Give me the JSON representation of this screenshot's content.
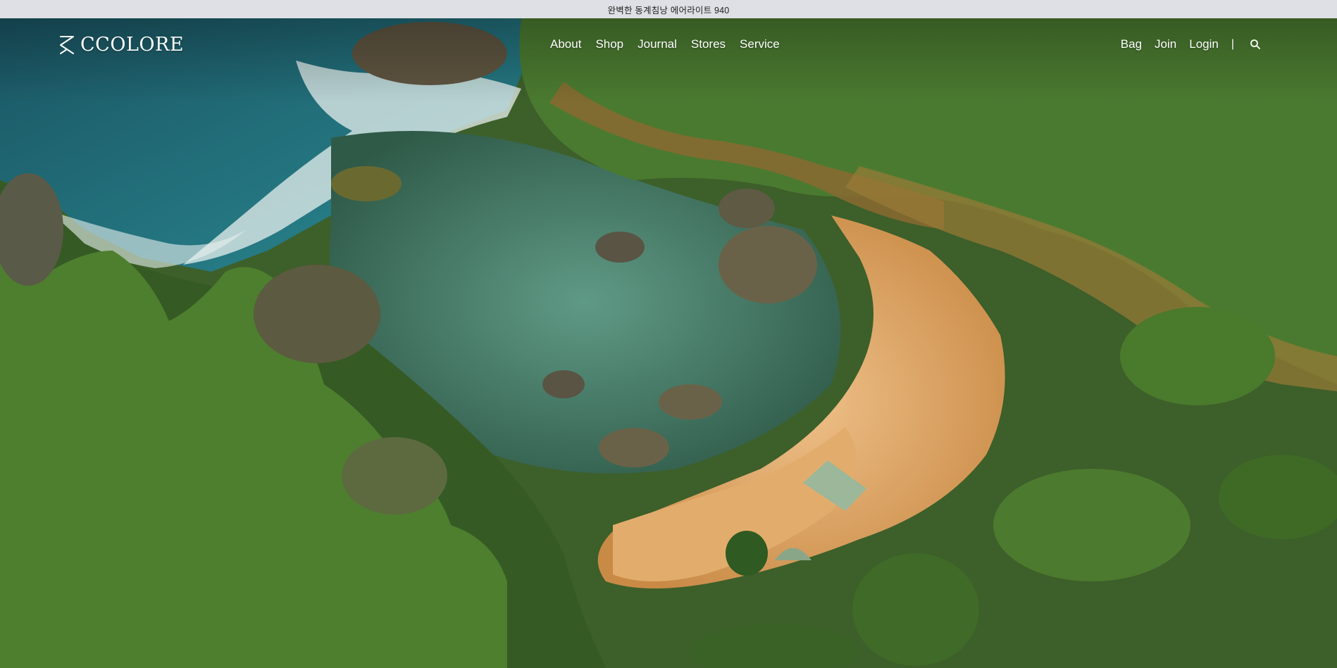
{
  "announcement": {
    "text": "완벽한 동계침낭 에어라이트 940"
  },
  "header": {
    "logo_text": "CCOLORE",
    "main_nav": [
      {
        "label": "About"
      },
      {
        "label": "Shop"
      },
      {
        "label": "Journal"
      },
      {
        "label": "Stores"
      },
      {
        "label": "Service"
      }
    ],
    "utility_nav": {
      "bag": "Bag",
      "join": "Join",
      "login": "Login",
      "divider": "|",
      "search_icon": "search-icon"
    }
  },
  "hero": {
    "image_subject": "aerial coastal cove with tents on sand beach",
    "colors": {
      "ocean": "#1f6a78",
      "lagoon": "#4f8a78",
      "sand": "#d9a25e",
      "vegetation": "#3f6a2c",
      "cliff": "#7a6a3c"
    }
  }
}
